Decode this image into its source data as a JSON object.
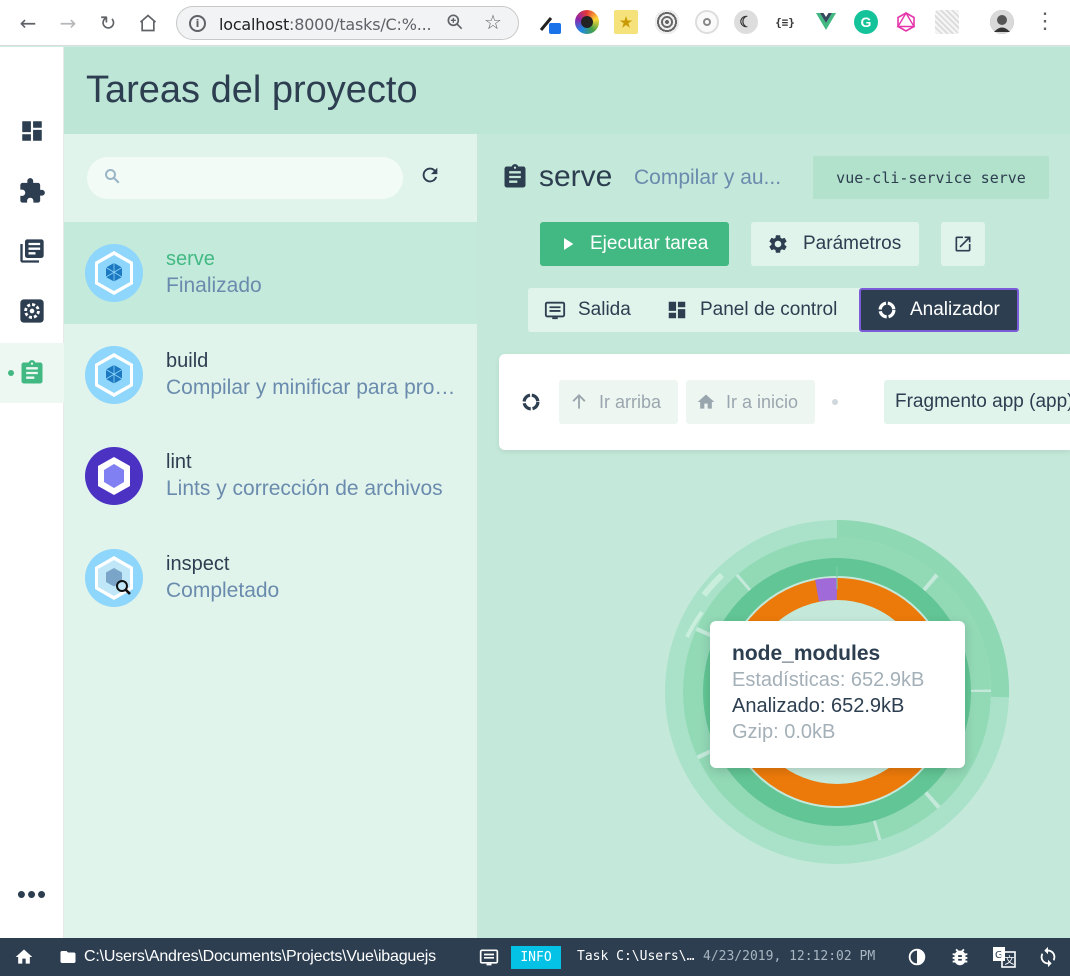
{
  "browser": {
    "url_host": "localhost",
    "url_rest": ":8000/tasks/C:%...",
    "extensions": [
      "eyedropper-ext",
      "color-wheel-ext",
      "image-ext",
      "grayscale-ext",
      "target-ext",
      "dark-mode-ext",
      "json-ext",
      "vue-devtools-ext",
      "grammarly-ext",
      "graphql-ext",
      "pattern-ext",
      "profile-avatar"
    ],
    "json_ext_label": "{≡}",
    "grammarly_label": "G"
  },
  "rail": {
    "items": [
      {
        "name": "dashboard",
        "active": false
      },
      {
        "name": "plugins",
        "active": false
      },
      {
        "name": "dependencies",
        "active": false
      },
      {
        "name": "configuration",
        "active": false
      },
      {
        "name": "tasks",
        "active": true
      }
    ],
    "more_label": "•••"
  },
  "header": {
    "title": "Tareas del proyecto"
  },
  "search": {
    "placeholder": ""
  },
  "tasks": [
    {
      "name": "serve",
      "description": "Finalizado",
      "icon": "webpack-icon",
      "selected": true
    },
    {
      "name": "build",
      "description": "Compilar y minificar para producción",
      "icon": "webpack-icon",
      "selected": false
    },
    {
      "name": "lint",
      "description": "Lints y corrección de archivos",
      "icon": "eslint-icon",
      "selected": false
    },
    {
      "name": "inspect",
      "description": "Completado",
      "icon": "webpack-inspect-icon",
      "selected": false
    }
  ],
  "detail": {
    "task_name": "serve",
    "task_description": "Compilar y au...",
    "command": "vue-cli-service serve",
    "run_label": "Ejecutar tarea",
    "params_label": "Parámetros",
    "tabs": [
      {
        "label": "Salida",
        "active": false
      },
      {
        "label": "Panel de control",
        "active": false
      },
      {
        "label": "Analizador",
        "active": true
      }
    ],
    "analyzer": {
      "up_label": "Ir arriba",
      "home_label": "Ir a inicio",
      "chunk_label": "Fragmento app (app)"
    },
    "tooltip": {
      "title": "node_modules",
      "stats_label": "Estadísticas: 652.9kB",
      "parsed_label": "Analizado: 652.9kB",
      "gzip_label": "Gzip: 0.0kB"
    }
  },
  "status_bar": {
    "path": "C:\\Users\\Andres\\Documents\\Projects\\Vue\\ibaguejs",
    "level_badge": "INFO",
    "message": "Task C:\\Users\\…",
    "timestamp": "4/23/2019, 12:12:02 PM"
  },
  "colors": {
    "accent": "#42b983",
    "dark": "#2c3e50",
    "info": "#03c2e6",
    "ring_orange": "#ec7a0a",
    "ring_purple": "#a06ad9"
  }
}
